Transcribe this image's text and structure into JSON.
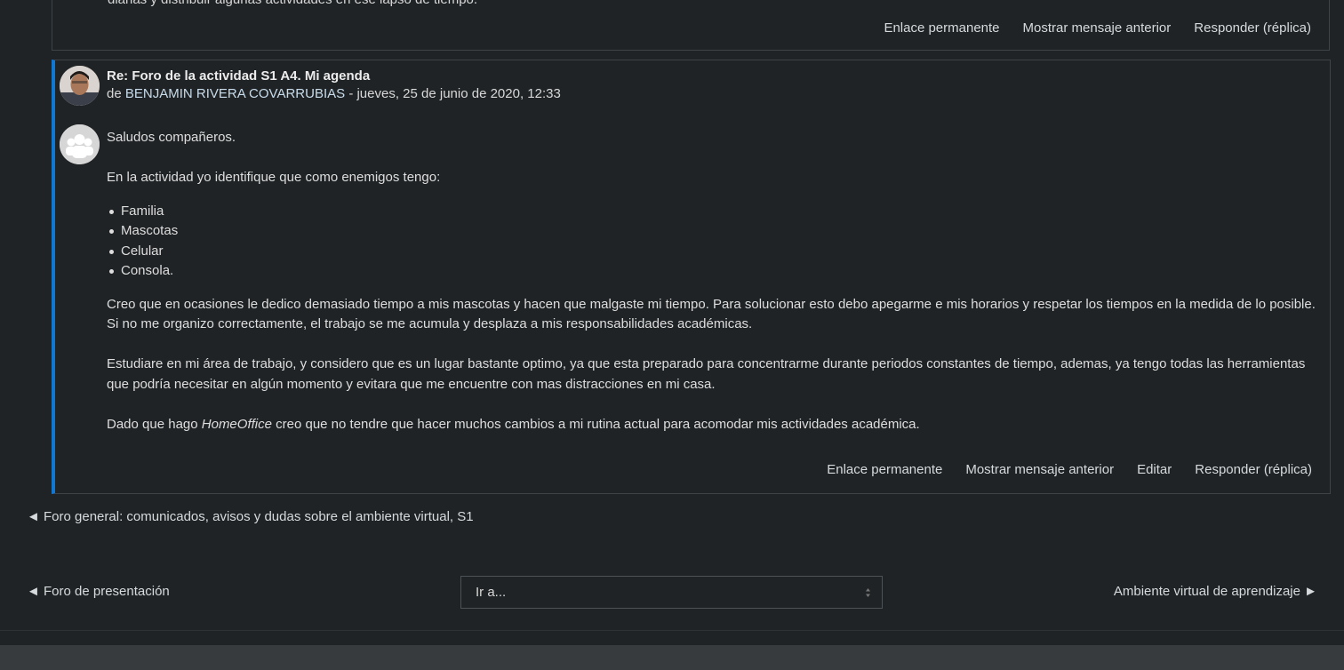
{
  "previous_post": {
    "cut_text": "diarias y distribuir algunas actividades en ese lapso de tiempo.",
    "actions": [
      "Enlace permanente",
      "Mostrar mensaje anterior",
      "Responder (réplica)"
    ]
  },
  "post": {
    "subject": "Re: Foro de la actividad S1 A4. Mi agenda",
    "by_prefix": "de",
    "author": "BENJAMIN RIVERA COVARRUBIAS",
    "date": "- jueves, 25 de junio de 2020, 12:33",
    "greeting": "Saludos compañeros.",
    "intro": "En la actividad yo identifique que como enemigos tengo:",
    "list": [
      "Familia",
      "Mascotas",
      "Celular",
      "Consola."
    ],
    "para1": "Creo que en ocasiones le dedico demasiado tiempo a mis mascotas y hacen que malgaste mi tiempo. Para solucionar esto debo apegarme e mis horarios y respetar los tiempos en la medida de lo posible. Si no me organizo correctamente, el trabajo se me acumula y desplaza a mis responsabilidades académicas.",
    "para2": "Estudiare en mi área de trabajo, y considero que es un lugar bastante optimo, ya que esta preparado para concentrarme durante periodos constantes de tiempo, ademas, ya tengo todas las herramientas que podría necesitar en algún momento y evitara que me encuentre con mas distracciones en mi casa.",
    "para3_before": "Dado que hago ",
    "para3_em": "HomeOffice",
    "para3_after": " creo que no tendre que hacer muchos cambios a mi rutina actual para acomodar mis actividades académica.",
    "actions": [
      "Enlace permanente",
      "Mostrar mensaje anterior",
      "Editar",
      "Responder (réplica)"
    ]
  },
  "nav": {
    "prev_discussion": "◄ Foro general: comunicados, avisos y dudas sobre el ambiente virtual, S1",
    "prev_activity": "◄ Foro de presentación",
    "jump_to": "Ir a...",
    "next_activity": "Ambiente virtual de aprendizaje ►"
  },
  "colors": {
    "accent": "#1177d1",
    "background": "#1f2325"
  }
}
